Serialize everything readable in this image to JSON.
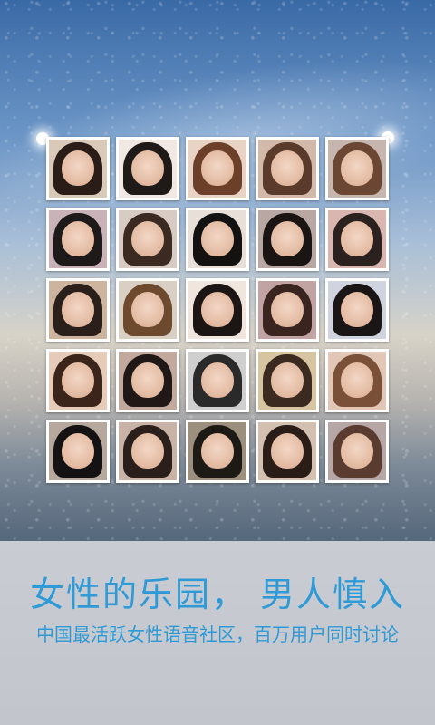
{
  "hero": {
    "photos": [
      {
        "bg": "#d9c9b8",
        "hair": "#2a1d18",
        "label": "user photo 1"
      },
      {
        "bg": "#f1e8e3",
        "hair": "#1f1a18",
        "label": "user photo 2"
      },
      {
        "bg": "#e9d3c5",
        "hair": "#6b3f2a",
        "label": "user photo 3"
      },
      {
        "bg": "#d3b9a9",
        "hair": "#5a3a2b",
        "label": "user photo 4"
      },
      {
        "bg": "#c7b6b0",
        "hair": "#6a4633",
        "label": "user photo 5"
      },
      {
        "bg": "#c9b3b8",
        "hair": "#1e1a1a",
        "label": "user photo 6"
      },
      {
        "bg": "#d8cbc3",
        "hair": "#3b2a22",
        "label": "user photo 7"
      },
      {
        "bg": "#e8e0d8",
        "hair": "#141211",
        "label": "user photo 8"
      },
      {
        "bg": "#b9a7a3",
        "hair": "#1a1412",
        "label": "user photo 9"
      },
      {
        "bg": "#d9b6b0",
        "hair": "#2b2220",
        "label": "user photo 10"
      },
      {
        "bg": "#cdb49e",
        "hair": "#2b1f1b",
        "label": "user photo 11"
      },
      {
        "bg": "#d9cfc3",
        "hair": "#6d4a2e",
        "label": "user photo 12"
      },
      {
        "bg": "#f0e6de",
        "hair": "#1b1614",
        "label": "user photo 13"
      },
      {
        "bg": "#c2a3a3",
        "hair": "#3a2420",
        "label": "user photo 14"
      },
      {
        "bg": "#cfd4df",
        "hair": "#1a1616",
        "label": "user photo 15"
      },
      {
        "bg": "#e6ccb8",
        "hair": "#3b2419",
        "label": "user photo 16"
      },
      {
        "bg": "#c2a89d",
        "hair": "#1f1816",
        "label": "user photo 17"
      },
      {
        "bg": "#cfcfcf",
        "hair": "#2a2a2a",
        "label": "user photo 18"
      },
      {
        "bg": "#d7c4a1",
        "hair": "#3a2a1f",
        "label": "user photo 19"
      },
      {
        "bg": "#e2c7b6",
        "hair": "#7a5038",
        "label": "user photo 20"
      },
      {
        "bg": "#b7a89d",
        "hair": "#141212",
        "label": "user photo 21"
      },
      {
        "bg": "#c9b3a7",
        "hair": "#2a1f1b",
        "label": "user photo 22"
      },
      {
        "bg": "#9c8f7d",
        "hair": "#1d1a16",
        "label": "user photo 23"
      },
      {
        "bg": "#d3c0b1",
        "hair": "#2a1d18",
        "label": "user photo 24"
      },
      {
        "bg": "#b7a6a6",
        "hair": "#5a3b30",
        "label": "user photo 25"
      }
    ]
  },
  "caption": {
    "headline": "女性的乐园，  男人慎入",
    "subline": "中国最活跃女性语音社区，百万用户同时讨论"
  },
  "colors": {
    "accent": "#2f9ad6",
    "photo_border": "#ffffff",
    "caption_bg": "#c7cbd1"
  }
}
